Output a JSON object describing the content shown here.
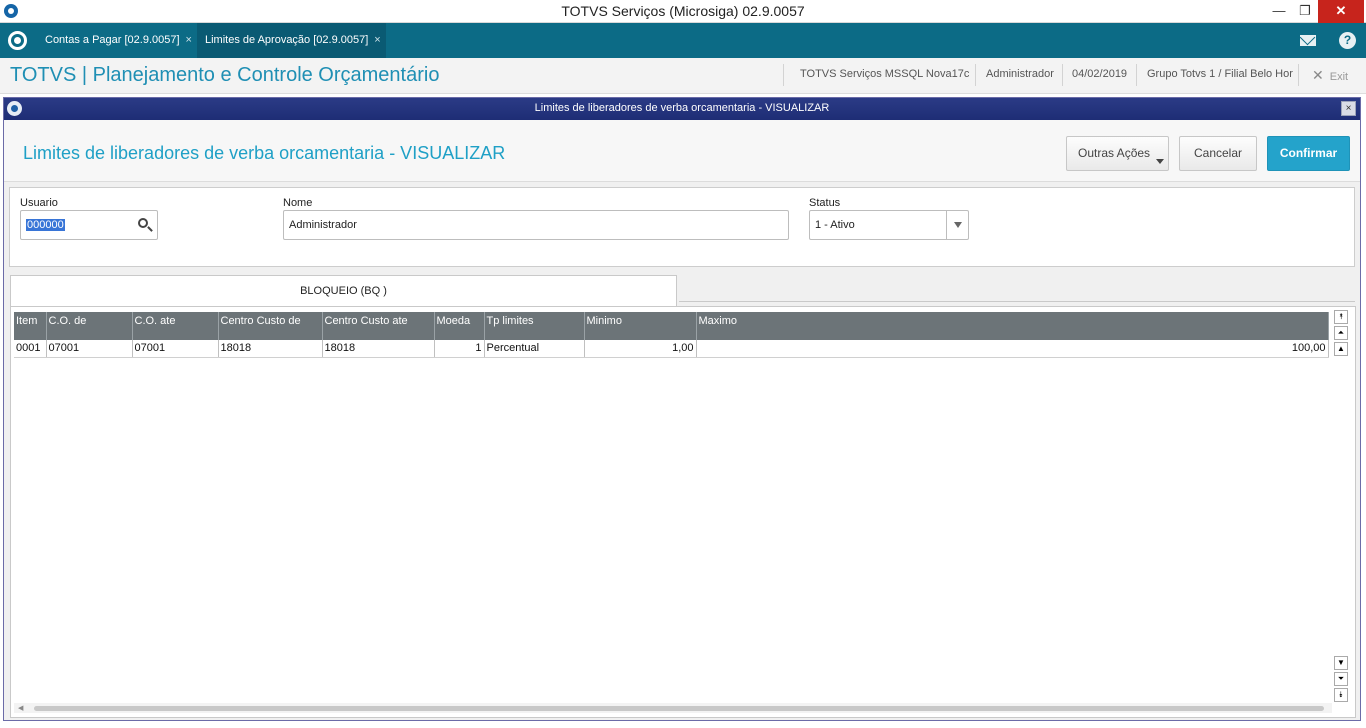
{
  "window": {
    "title": "TOTVS Serviços (Microsiga) 02.9.0057",
    "minimize": "—",
    "maximize": "❐",
    "close": "✕"
  },
  "tabs": [
    {
      "label": "Contas a Pagar [02.9.0057]",
      "close": "×"
    },
    {
      "label": "Limites de Aprovação [02.9.0057]",
      "close": "×"
    }
  ],
  "header": {
    "module_title": "TOTVS | Planejamento e Controle Orçamentário",
    "environment": "TOTVS Serviços MSSQL Nova17c",
    "user": "Administrador",
    "date": "04/02/2019",
    "branch": "Grupo Totvs 1 / Filial Belo Hor",
    "exit_label": "Exit",
    "exit_icon": "✕"
  },
  "dialog": {
    "title": "Limites de liberadores de verba orcamentaria - VISUALIZAR",
    "close": "×",
    "page_title": "Limites de liberadores de verba orcamentaria - VISUALIZAR",
    "buttons": {
      "outras_acoes": "Outras Ações",
      "cancelar": "Cancelar",
      "confirmar": "Confirmar"
    },
    "form": {
      "usuario_label": "Usuario",
      "usuario_value": "000000",
      "nome_label": "Nome",
      "nome_value": "Administrador",
      "status_label": "Status",
      "status_value": "1 - Ativo"
    },
    "tab_label": "BLOQUEIO (BQ )",
    "grid": {
      "columns": [
        "Item",
        "C.O. de",
        "C.O. ate",
        "Centro Custo de",
        "Centro Custo ate",
        "Moeda",
        "Tp limites",
        "Minimo",
        "Maximo"
      ],
      "rows": [
        [
          "0001",
          "07001",
          "07001",
          "18018",
          "18018",
          "1",
          "Percentual",
          "1,00",
          "100,00"
        ]
      ]
    }
  }
}
